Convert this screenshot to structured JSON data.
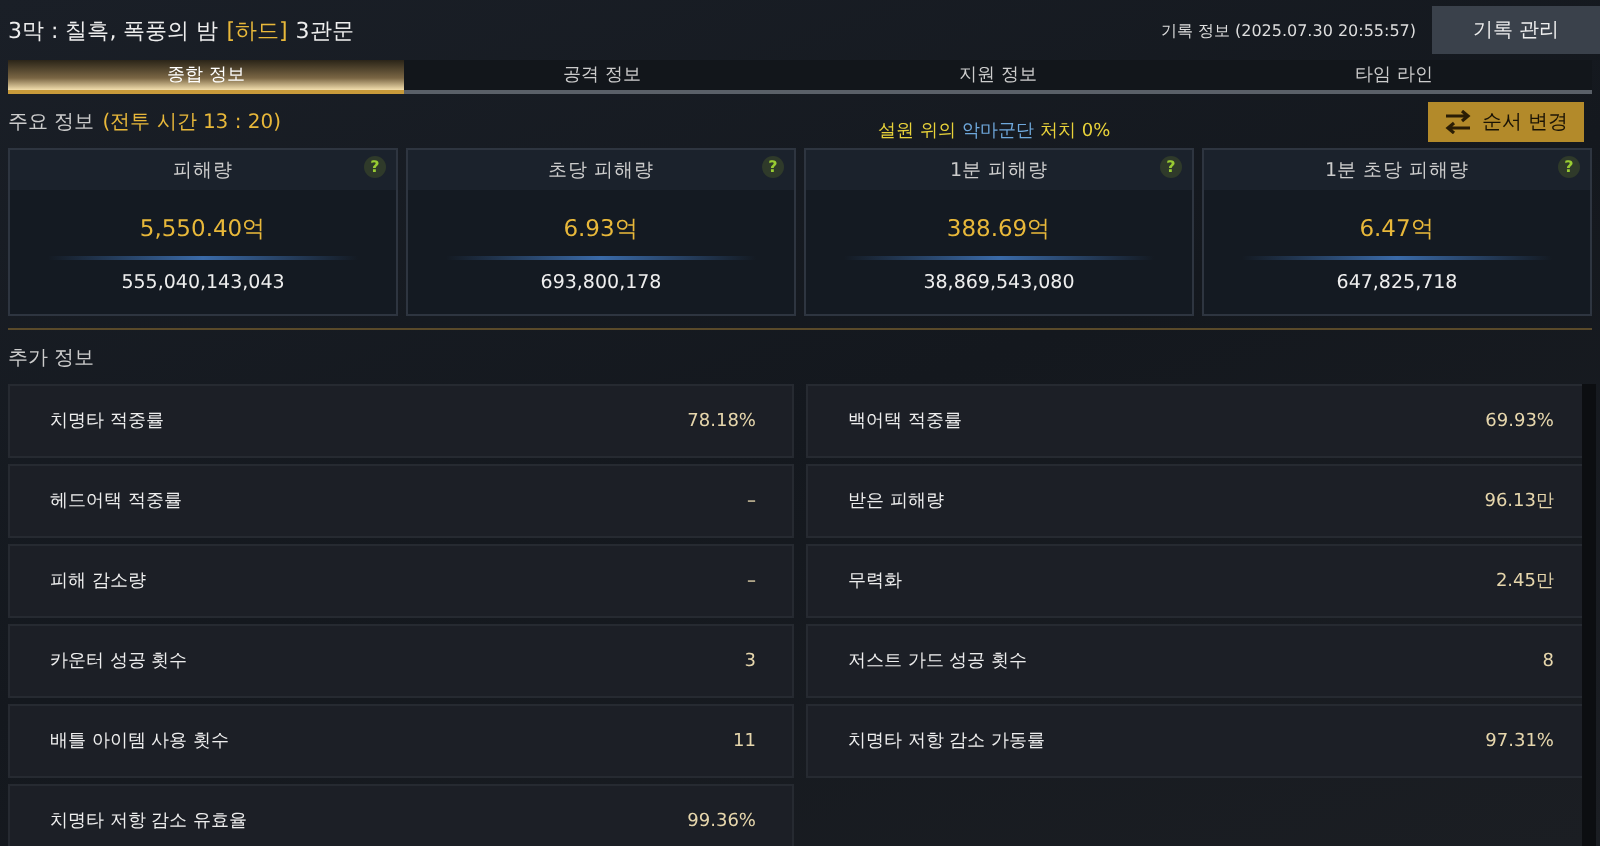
{
  "header": {
    "title": "3막 : 칠흑, 폭풍의 밤",
    "difficulty": "[하드]",
    "stage": "3관문",
    "record_info": "기록 정보 (2025.07.30 20:55:57)",
    "manage_button": "기록 관리"
  },
  "tabs": [
    {
      "label": "종합 정보",
      "selected": true
    },
    {
      "label": "공격 정보",
      "selected": false
    },
    {
      "label": "지원 정보",
      "selected": false
    },
    {
      "label": "타임 라인",
      "selected": false
    }
  ],
  "main_info": {
    "title": "주요 정보",
    "battle_time": "(전투 시간 13 : 20)",
    "objective": [
      {
        "text": "설원 위의",
        "color": "#e8d23a"
      },
      {
        "text": "악마군단",
        "color": "#6fa8dc"
      },
      {
        "text": "처치 0%",
        "color": "#e8d23a"
      }
    ],
    "order_button": "순서 변경"
  },
  "stat_cards": [
    {
      "label": "피해량",
      "value": "5,550.40억",
      "raw": "555,040,143,043",
      "help": "?"
    },
    {
      "label": "초당 피해량",
      "value": "6.93억",
      "raw": "693,800,178",
      "help": "?"
    },
    {
      "label": "1분 피해량",
      "value": "388.69억",
      "raw": "38,869,543,080",
      "help": "?"
    },
    {
      "label": "1분 초당 피해량",
      "value": "6.47억",
      "raw": "647,825,718",
      "help": "?"
    }
  ],
  "extra_info": {
    "title": "추가 정보",
    "left": [
      {
        "label": "치명타 적중률",
        "value": "78.18%"
      },
      {
        "label": "헤드어택 적중률",
        "value": "–"
      },
      {
        "label": "피해 감소량",
        "value": "–"
      },
      {
        "label": "카운터 성공 횟수",
        "value": "3"
      },
      {
        "label": "배틀 아이템 사용 횟수",
        "value": "11"
      },
      {
        "label": "치명타 저항 감소 유효율",
        "value": "99.36%"
      }
    ],
    "right": [
      {
        "label": "백어택 적중률",
        "value": "69.93%"
      },
      {
        "label": "받은 피해량",
        "value": "96.13만"
      },
      {
        "label": "무력화",
        "value": "2.45만"
      },
      {
        "label": "저스트 가드 성공 횟수",
        "value": "8"
      },
      {
        "label": "치명타 저항 감소 가동률",
        "value": "97.31%"
      }
    ]
  }
}
